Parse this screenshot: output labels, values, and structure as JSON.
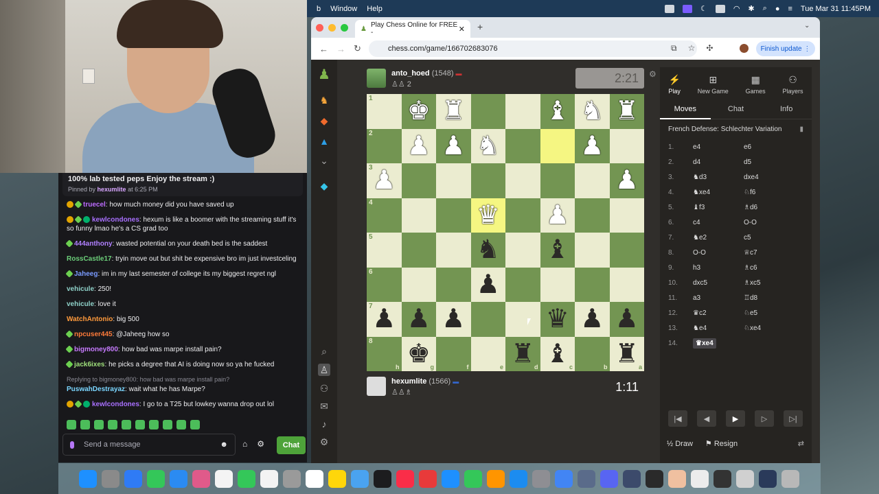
{
  "menubar": {
    "items": [
      "b",
      "Window",
      "Help"
    ],
    "datetime": "Tue Mar 31  11:45PM"
  },
  "chat": {
    "pinned": {
      "text": "100% lab tested peps Enjoy the stream :)",
      "pinned_by_prefix": "Pinned by",
      "pinned_by_user": "hexumlite",
      "pinned_at": "at 6:25 PM"
    },
    "messages": [
      {
        "user": "truecel",
        "color": "#bc6cff",
        "badges": [
          "gold",
          "green"
        ],
        "text": "how much money did you have saved up"
      },
      {
        "user": "kewlcondones",
        "color": "#a970ff",
        "badges": [
          "gold",
          "green",
          "verif"
        ],
        "text": "hexum is like a boomer with the streaming stuff it's so funny lmao he's a CS grad too"
      },
      {
        "user": "444anthony",
        "color": "#b080ff",
        "badges": [
          "green"
        ],
        "text": "wasted potential on your death bed is the saddest"
      },
      {
        "user": "RossCastle17",
        "color": "#6ccf7a",
        "badges": [],
        "text": "tryin move out but shit be expensive bro im just investceling"
      },
      {
        "user": "Jaheeg",
        "color": "#7a9bff",
        "badges": [
          "green"
        ],
        "text": "im in my last semester of college its my biggest regret ngl"
      },
      {
        "user": "vehicule",
        "color": "#8fd1c9",
        "badges": [],
        "text": "250!"
      },
      {
        "user": "vehicule",
        "color": "#8fd1c9",
        "badges": [],
        "text": "love it"
      },
      {
        "user": "WatchAntonio",
        "color": "#ff9a3c",
        "badges": [],
        "text": "big 500"
      },
      {
        "user": "npcuser445",
        "color": "#ff7b3a",
        "badges": [
          "green"
        ],
        "text": "@Jaheeg how so"
      },
      {
        "user": "bigmoney800",
        "color": "#c77bff",
        "badges": [
          "green"
        ],
        "text": "how bad was marpe install pain?"
      },
      {
        "user": "jack6ixes",
        "color": "#9fe07b",
        "badges": [
          "green"
        ],
        "text": "he picks a degree that AI is doing now so ya he fucked"
      },
      {
        "user": "PuswahDestrayaz",
        "color": "#7bd6ff",
        "badges": [],
        "reply": "Replying to bigmoney800: how bad was marpe install pain?",
        "text": "wait what he has Marpe?"
      },
      {
        "user": "kewlcondones",
        "color": "#a970ff",
        "badges": [
          "gold",
          "green",
          "verif"
        ],
        "text": "I go to a T25 but lowkey wanna drop out lol"
      }
    ],
    "input_placeholder": "Send a message",
    "chat_button": "Chat"
  },
  "browser": {
    "tab_title": "Play Chess Online for FREE -",
    "url": "chess.com/game/166702683076",
    "finish_update": "Finish update"
  },
  "game": {
    "top_player": {
      "name": "anto_hoed",
      "rating": "(1548)",
      "clock": "2:21"
    },
    "bottom_player": {
      "name": "hexumlite",
      "rating": "(1566)",
      "clock": "1:11"
    },
    "ranks": [
      "1",
      "2",
      "3",
      "4",
      "5",
      "6",
      "7",
      "8"
    ],
    "files": [
      "h",
      "g",
      "f",
      "e",
      "d",
      "c",
      "b",
      "a"
    ],
    "board": [
      [
        "",
        "wK",
        "wR",
        "",
        "",
        "wB",
        "wN",
        "wR"
      ],
      [
        "",
        "wP",
        "wP",
        "wN",
        "",
        "",
        "wP",
        ""
      ],
      [
        "wP",
        "",
        "",
        "",
        "",
        "",
        "",
        "wP"
      ],
      [
        "",
        "",
        "",
        "wQ",
        "",
        "wP",
        "",
        ""
      ],
      [
        "",
        "",
        "",
        "bN",
        "",
        "bB",
        "",
        ""
      ],
      [
        "",
        "",
        "",
        "bP",
        "",
        "",
        "",
        ""
      ],
      [
        "bP",
        "bP",
        "bP",
        "",
        "",
        "bQ",
        "bP",
        "bP"
      ],
      [
        "",
        "bK",
        "",
        "",
        "bR",
        "bB",
        "",
        "bR"
      ]
    ],
    "highlights": [
      "1-5",
      "3-3"
    ],
    "panel_tabs": [
      "Play",
      "New Game",
      "Games",
      "Players"
    ],
    "sub_tabs": [
      "Moves",
      "Chat",
      "Info"
    ],
    "opening": "French Defense: Schlechter Variation",
    "moves": [
      {
        "n": "1.",
        "w": "e4",
        "b": "e6"
      },
      {
        "n": "2.",
        "w": "d4",
        "b": "d5"
      },
      {
        "n": "3.",
        "w": "♞d3",
        "b": "dxe4"
      },
      {
        "n": "4.",
        "w": "♞xe4",
        "b": "♘f6"
      },
      {
        "n": "5.",
        "w": "♝f3",
        "b": "♗d6"
      },
      {
        "n": "6.",
        "w": "c4",
        "b": "O-O"
      },
      {
        "n": "7.",
        "w": "♞e2",
        "b": "c5"
      },
      {
        "n": "8.",
        "w": "O-O",
        "b": "♕c7"
      },
      {
        "n": "9.",
        "w": "h3",
        "b": "♗c6"
      },
      {
        "n": "10.",
        "w": "dxc5",
        "b": "♗xc5"
      },
      {
        "n": "11.",
        "w": "a3",
        "b": "♖d8"
      },
      {
        "n": "12.",
        "w": "♛c2",
        "b": "♘e5"
      },
      {
        "n": "13.",
        "w": "♞e4",
        "b": "♘xe4"
      },
      {
        "n": "14.",
        "w": "♛xe4",
        "b": ""
      }
    ],
    "draw": "Draw",
    "resign": "Resign"
  }
}
